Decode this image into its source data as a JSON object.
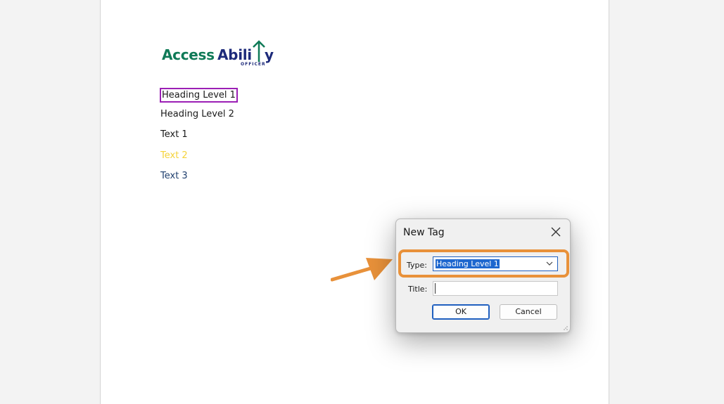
{
  "logo": {
    "part_access": "Access",
    "part_abili": "Abili",
    "part_y": "y",
    "subtext": "OFFICER",
    "colors": {
      "green": "#0f7a57",
      "navy": "#1d2a7a"
    }
  },
  "document": {
    "lines": [
      {
        "text": "Heading Level 1",
        "color": "#1a1a1a",
        "selected": true
      },
      {
        "text": "Heading Level 2",
        "color": "#1a1a1a"
      },
      {
        "text": "Text 1",
        "color": "#1a1a1a"
      },
      {
        "text": "Text 2",
        "color": "#f5d33a"
      },
      {
        "text": "Text 3",
        "color": "#1f3f6e"
      }
    ],
    "selection_color": "#9b1fb5"
  },
  "dialog": {
    "title": "New Tag",
    "close_icon": "close-icon",
    "type_label": "Type:",
    "type_value": "Heading Level 1",
    "title_label": "Title:",
    "title_value": "",
    "ok_label": "OK",
    "cancel_label": "Cancel"
  },
  "annotation": {
    "highlight_color": "#e8913a",
    "arrow_icon": "arrow-right-icon"
  }
}
